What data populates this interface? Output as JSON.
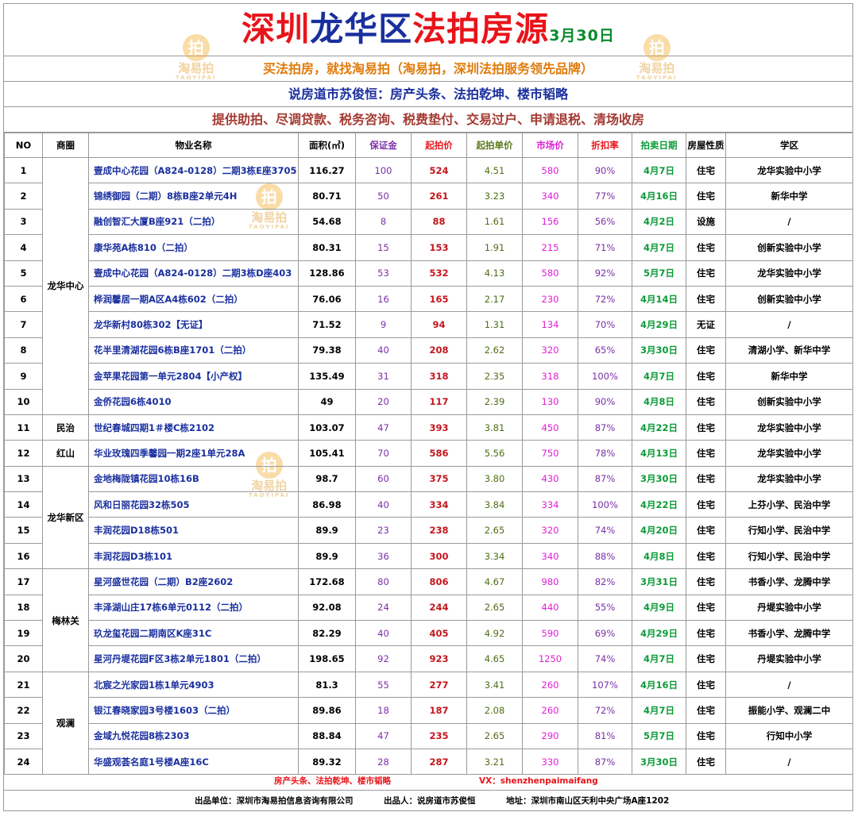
{
  "header": {
    "title_part1": "深圳",
    "title_part2": "龙华区",
    "title_part3": "法拍房源",
    "date": "3月30日",
    "line2": "买法拍房，就找淘易拍（淘易拍，深圳法拍服务领先品牌）",
    "line3": "说房道市苏俊恒：房产头条、法拍乾坤、楼市韬略",
    "line4": "提供助拍、尽调贷款、税务咨询、税费垫付、交易过户、申请退税、清场收房"
  },
  "watermark": {
    "text": "淘易拍",
    "subtext": "TAOYIPAI"
  },
  "columns": {
    "no": "NO",
    "district": "商圈",
    "name": "物业名称",
    "area": "面积(㎡)",
    "deposit": "保证金",
    "start": "起拍价",
    "unit": "起拍单价",
    "market": "市场价",
    "discount": "折扣率",
    "date": "拍卖日期",
    "type": "房屋性质",
    "school": "学区"
  },
  "districts": [
    "龙华中心",
    "民治",
    "红山",
    "龙华新区",
    "梅林关",
    "观澜"
  ],
  "rows": [
    {
      "no": "1",
      "name": "壹成中心花园（A824-0128）二期3栋E座3705",
      "area": "116.27",
      "deposit": "100",
      "start": "524",
      "unit": "4.51",
      "market": "580",
      "discount": "90%",
      "date": "4月7日",
      "type": "住宅",
      "school": "龙华实验中小学"
    },
    {
      "no": "2",
      "name": "锦绣御园（二期）8栋B座2单元4H",
      "area": "80.71",
      "deposit": "50",
      "start": "261",
      "unit": "3.23",
      "market": "340",
      "discount": "77%",
      "date": "4月16日",
      "type": "住宅",
      "school": "新华中学"
    },
    {
      "no": "3",
      "name": "融创智汇大厦B座921（二拍）",
      "area": "54.68",
      "deposit": "8",
      "start": "88",
      "unit": "1.61",
      "market": "156",
      "discount": "56%",
      "date": "4月2日",
      "type": "设施",
      "school": "/"
    },
    {
      "no": "4",
      "name": "康华苑A栋810（二拍）",
      "area": "80.31",
      "deposit": "15",
      "start": "153",
      "unit": "1.91",
      "market": "215",
      "discount": "71%",
      "date": "4月7日",
      "type": "住宅",
      "school": "创新实验中小学"
    },
    {
      "no": "5",
      "name": "壹成中心花园（A824-0128）二期3栋D座403",
      "area": "128.86",
      "deposit": "53",
      "start": "532",
      "unit": "4.13",
      "market": "580",
      "discount": "92%",
      "date": "5月7日",
      "type": "住宅",
      "school": "龙华实验中小学"
    },
    {
      "no": "6",
      "name": "桦润馨居一期A区A4栋602（二拍）",
      "area": "76.06",
      "deposit": "16",
      "start": "165",
      "unit": "2.17",
      "market": "230",
      "discount": "72%",
      "date": "4月14日",
      "type": "住宅",
      "school": "创新实验中小学"
    },
    {
      "no": "7",
      "name": "龙华新村80栋302【无证】",
      "area": "71.52",
      "deposit": "9",
      "start": "94",
      "unit": "1.31",
      "market": "134",
      "discount": "70%",
      "date": "4月29日",
      "type": "无证",
      "school": "/"
    },
    {
      "no": "8",
      "name": "花半里清湖花园6栋B座1701（二拍）",
      "area": "79.38",
      "deposit": "40",
      "start": "208",
      "unit": "2.62",
      "market": "320",
      "discount": "65%",
      "date": "3月30日",
      "type": "住宅",
      "school": "清湖小学、新华中学"
    },
    {
      "no": "9",
      "name": "金苹果花园第一单元2804【小产权】",
      "area": "135.49",
      "deposit": "31",
      "start": "318",
      "unit": "2.35",
      "market": "318",
      "discount": "100%",
      "date": "4月7日",
      "type": "住宅",
      "school": "新华中学"
    },
    {
      "no": "10",
      "name": "金侨花园6栋4010",
      "area": "49",
      "deposit": "20",
      "start": "117",
      "unit": "2.39",
      "market": "130",
      "discount": "90%",
      "date": "4月8日",
      "type": "住宅",
      "school": "创新实验中小学"
    },
    {
      "no": "11",
      "name": "世纪春城四期1＃楼C栋2102",
      "area": "103.07",
      "deposit": "47",
      "start": "393",
      "unit": "3.81",
      "market": "450",
      "discount": "87%",
      "date": "4月22日",
      "type": "住宅",
      "school": "龙华实验中小学"
    },
    {
      "no": "12",
      "name": "华业玫瑰四季馨园一期2座1单元28A",
      "area": "105.41",
      "deposit": "70",
      "start": "586",
      "unit": "5.56",
      "market": "750",
      "discount": "78%",
      "date": "4月13日",
      "type": "住宅",
      "school": "龙华实验中小学"
    },
    {
      "no": "13",
      "name": "金地梅陇镇花园10栋16B",
      "area": "98.7",
      "deposit": "60",
      "start": "375",
      "unit": "3.80",
      "market": "430",
      "discount": "87%",
      "date": "3月30日",
      "type": "住宅",
      "school": "龙华实验中小学"
    },
    {
      "no": "14",
      "name": "风和日丽花园32栋505",
      "area": "86.98",
      "deposit": "40",
      "start": "334",
      "unit": "3.84",
      "market": "334",
      "discount": "100%",
      "date": "4月22日",
      "type": "住宅",
      "school": "上芬小学、民治中学"
    },
    {
      "no": "15",
      "name": "丰润花园D18栋501",
      "area": "89.9",
      "deposit": "23",
      "start": "238",
      "unit": "2.65",
      "market": "320",
      "discount": "74%",
      "date": "4月20日",
      "type": "住宅",
      "school": "行知小学、民治中学"
    },
    {
      "no": "16",
      "name": "丰润花园D3栋101",
      "area": "89.9",
      "deposit": "36",
      "start": "300",
      "unit": "3.34",
      "market": "340",
      "discount": "88%",
      "date": "4月8日",
      "type": "住宅",
      "school": "行知小学、民治中学"
    },
    {
      "no": "17",
      "name": "星河盛世花园（二期）B2座2602",
      "area": "172.68",
      "deposit": "80",
      "start": "806",
      "unit": "4.67",
      "market": "980",
      "discount": "82%",
      "date": "3月31日",
      "type": "住宅",
      "school": "书香小学、龙腾中学"
    },
    {
      "no": "18",
      "name": "丰泽湖山庄17栋6单元0112（二拍）",
      "area": "92.08",
      "deposit": "24",
      "start": "244",
      "unit": "2.65",
      "market": "440",
      "discount": "55%",
      "date": "4月9日",
      "type": "住宅",
      "school": "丹堤实验中小学"
    },
    {
      "no": "19",
      "name": "玖龙玺花园二期南区K座31C",
      "area": "82.29",
      "deposit": "40",
      "start": "405",
      "unit": "4.92",
      "market": "590",
      "discount": "69%",
      "date": "4月29日",
      "type": "住宅",
      "school": "书香小学、龙腾中学"
    },
    {
      "no": "20",
      "name": "星河丹堤花园F区3栋2单元1801（二拍）",
      "area": "198.65",
      "deposit": "92",
      "start": "923",
      "unit": "4.65",
      "market": "1250",
      "discount": "74%",
      "date": "4月7日",
      "type": "住宅",
      "school": "丹堤实验中小学"
    },
    {
      "no": "21",
      "name": "北宸之光家园1栋1单元4903",
      "area": "81.3",
      "deposit": "55",
      "start": "277",
      "unit": "3.41",
      "market": "260",
      "discount": "107%",
      "date": "4月16日",
      "type": "住宅",
      "school": "/"
    },
    {
      "no": "22",
      "name": "银江春晓家园3号楼1603（二拍）",
      "area": "89.86",
      "deposit": "18",
      "start": "187",
      "unit": "2.08",
      "market": "260",
      "discount": "72%",
      "date": "4月7日",
      "type": "住宅",
      "school": "振能小学、观澜二中"
    },
    {
      "no": "23",
      "name": "金域九悦花园8栋2303",
      "area": "88.84",
      "deposit": "47",
      "start": "235",
      "unit": "2.65",
      "market": "290",
      "discount": "81%",
      "date": "5月7日",
      "type": "住宅",
      "school": "行知中小学"
    },
    {
      "no": "24",
      "name": "华盛观荟名庭1号楼A座16C",
      "area": "89.32",
      "deposit": "28",
      "start": "287",
      "unit": "3.21",
      "market": "330",
      "discount": "87%",
      "date": "3月30日",
      "type": "住宅",
      "school": "/"
    }
  ],
  "footer": {
    "brand_line": "房产头条、法拍乾坤、楼市韬略",
    "vx": "VX：shenzhenpaimaifang",
    "producer_unit": "出品单位：深圳市淘易拍信息咨询有限公司",
    "producer": "出品人：说房道市苏俊恒",
    "address": "地址：深圳市南山区天利中央广场A座1202"
  }
}
